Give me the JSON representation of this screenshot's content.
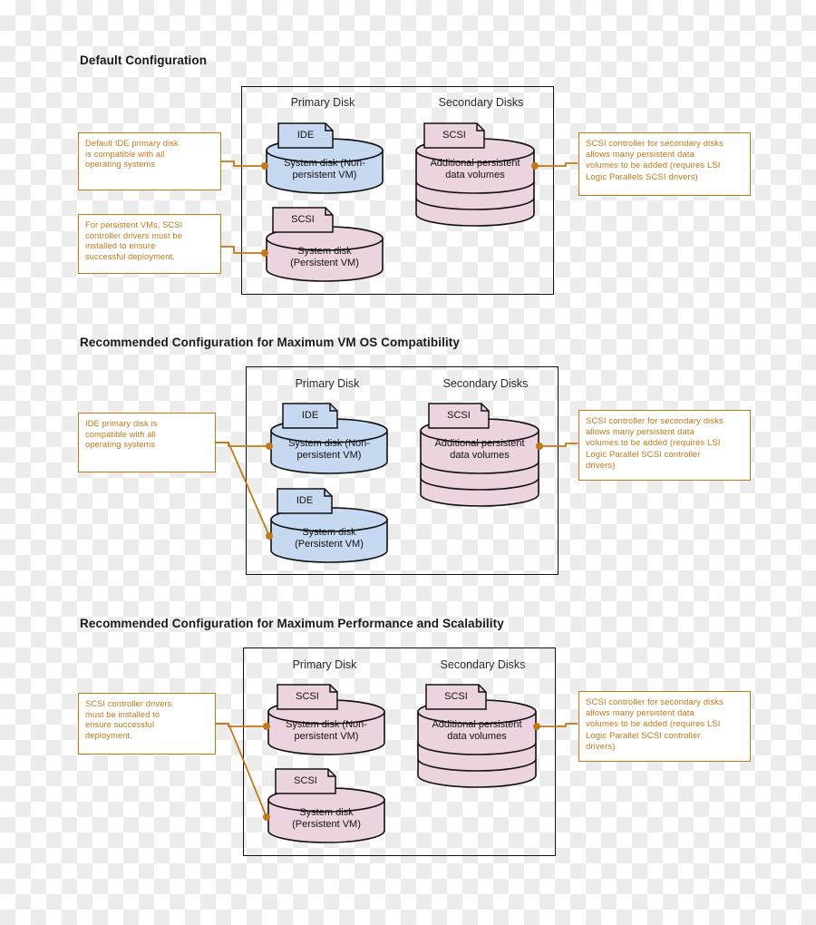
{
  "colors": {
    "accent_orange": "#c07818",
    "ide_blue": "#c6d9f1",
    "scsi_pink": "#ecd3e0",
    "outline": "#111111",
    "title_text": "#1a1a1a"
  },
  "common": {
    "primary_header": "Primary Disk",
    "secondary_header": "Secondary Disks",
    "tag_ide": "IDE",
    "tag_scsi": "SCSI",
    "disk_nonpersistent_line1": "System disk (Non-",
    "disk_nonpersistent_line2": "persistent VM)",
    "disk_persistent_line1": "System disk",
    "disk_persistent_line2": "(Persistent VM)",
    "disk_secondary_line1": "Additional persistent",
    "disk_secondary_line2": "data volumes"
  },
  "sections": [
    {
      "id": "default-configuration",
      "title": "Default Configuration",
      "primary": {
        "top_disk": {
          "tag": "IDE",
          "fill": "ide_blue",
          "label_line1": "System disk (Non-",
          "label_line2": "persistent VM)"
        },
        "bottom_disk": {
          "tag": "SCSI",
          "fill": "scsi_pink",
          "label_line1": "System disk",
          "label_line2": "(Persistent VM)"
        }
      },
      "secondary": {
        "tag": "SCSI",
        "fill": "scsi_pink",
        "label_line1": "Additional persistent",
        "label_line2": "data volumes"
      },
      "callout_left_top": {
        "lines": [
          "Default IDE primary disk",
          "is compatible with all",
          "operating systems"
        ]
      },
      "callout_left_bottom": {
        "lines": [
          "For persistent VMs, SCSI",
          "controller drivers must be",
          "installed to ensure",
          "successful deployment."
        ]
      },
      "callout_right": {
        "lines": [
          "SCSI controller for secondary disks",
          "allows many persistent data",
          "volumes to be added (requires LSI",
          "Logic Parallels SCSI drivers)"
        ]
      }
    },
    {
      "id": "max-vm-os-compatibility",
      "title": "Recommended Configuration for Maximum VM OS Compatibility",
      "primary": {
        "top_disk": {
          "tag": "IDE",
          "fill": "ide_blue",
          "label_line1": "System disk (Non-",
          "label_line2": "persistent VM)"
        },
        "bottom_disk": {
          "tag": "IDE",
          "fill": "ide_blue",
          "label_line1": "System disk",
          "label_line2": "(Persistent VM)"
        }
      },
      "secondary": {
        "tag": "SCSI",
        "fill": "scsi_pink",
        "label_line1": "Additional persistent",
        "label_line2": "data volumes"
      },
      "callout_left_top": {
        "lines": [
          "IDE primary disk is",
          "compatible with all",
          "operating systems"
        ]
      },
      "callout_right": {
        "lines": [
          "SCSI controller for secondary disks",
          "allows many persistent data",
          "volumes to be added (requires LSI",
          "Logic Parallel SCSI controller",
          "drivers)"
        ]
      }
    },
    {
      "id": "max-performance-scalability",
      "title": "Recommended Configuration for Maximum Performance and Scalability",
      "primary": {
        "top_disk": {
          "tag": "SCSI",
          "fill": "scsi_pink",
          "label_line1": "System disk (Non-",
          "label_line2": "persistent VM)"
        },
        "bottom_disk": {
          "tag": "SCSI",
          "fill": "scsi_pink",
          "label_line1": "System disk",
          "label_line2": "(Persistent VM)"
        }
      },
      "secondary": {
        "tag": "SCSI",
        "fill": "scsi_pink",
        "label_line1": "Additional persistent",
        "label_line2": "data volumes"
      },
      "callout_left_top": {
        "lines": [
          "SCSI controller drivers",
          "must be installed to",
          "ensure successful",
          "deployment."
        ]
      },
      "callout_right": {
        "lines": [
          "SCSI controller for secondary disks",
          "allows many persistent data",
          "volumes to be added (requires LSI",
          "Logic Parallel SCSI controller",
          "drivers)"
        ]
      }
    }
  ]
}
